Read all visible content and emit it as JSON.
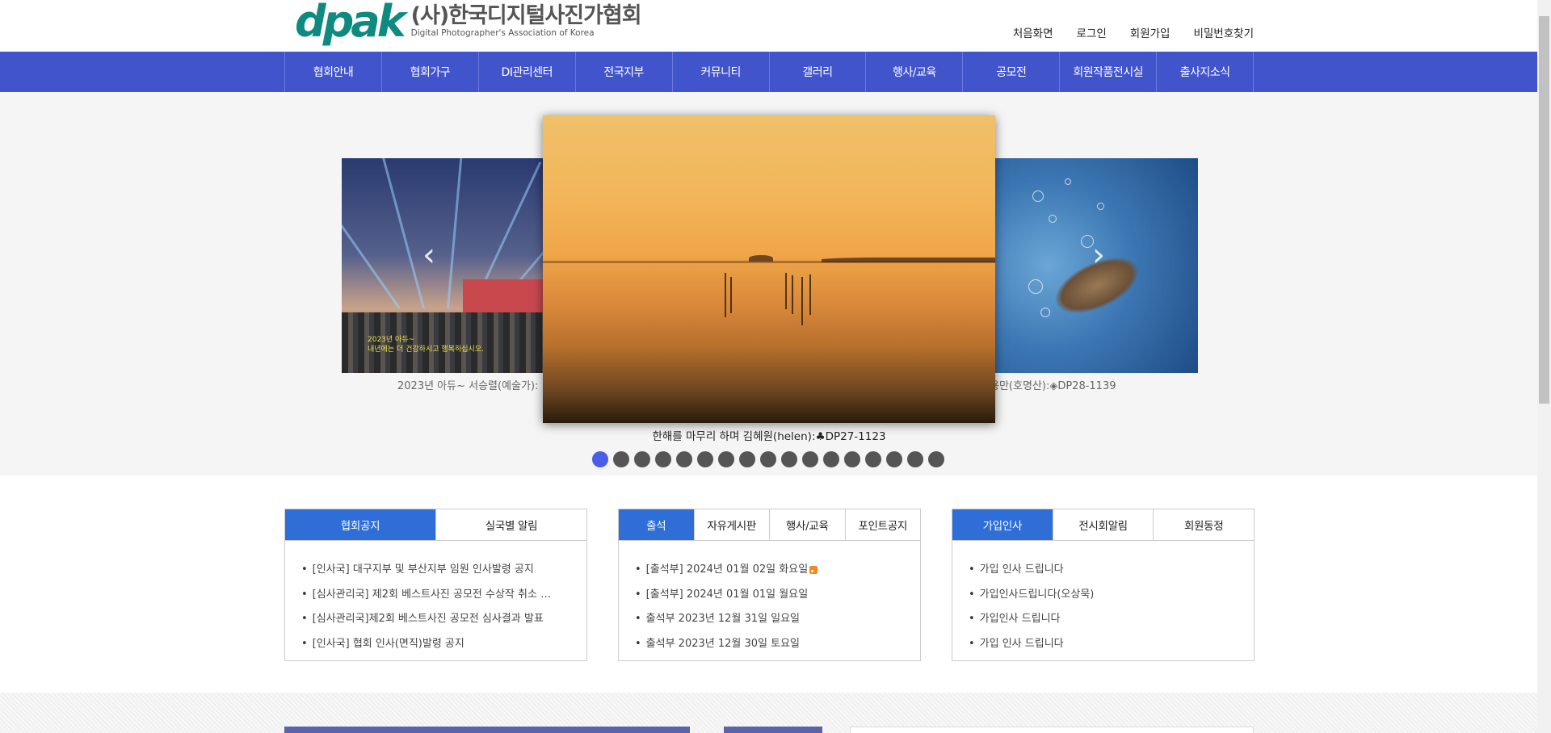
{
  "header": {
    "logo_mark": "dpak",
    "logo_title": "(사)한국디지털사진가협회",
    "logo_subtitle": "Digital Photographer's Association of Korea",
    "links": [
      "처음화면",
      "로그인",
      "회원가입",
      "비밀번호찾기"
    ]
  },
  "nav": {
    "items": [
      "협회안내",
      "협회가구",
      "DI관리센터",
      "전국지부",
      "커뮤니티",
      "갤러리",
      "행사/교육",
      "공모전",
      "회원작품전시실",
      "출사지소식"
    ]
  },
  "slider": {
    "left_overlay": "2023년 아듀~\n내년에는 더 건강하시고 행복하십시오.",
    "left_caption": "2023년 아듀~ 서승렬(예술가):",
    "right_caption": "용만(호명산):◈DP28-1139",
    "main_caption": "한해를 마무리 하며 김혜원(helen):♣DP27-1123",
    "dot_count": 17,
    "active_dot": 0,
    "prev_icon": "chevron-left-icon",
    "next_icon": "chevron-right-icon"
  },
  "boards": [
    {
      "tabs": [
        "협회공지",
        "실국별 알림"
      ],
      "active": 0,
      "items": [
        "[인사국] 대구지부 및 부산지부 임원 인사발령 공지",
        "[심사관리국] 제2회 베스트사진 공모전 수상작 취소 …",
        "[심사관리국]제2회 베스트사진 공모전 심사결과 발표",
        "[인사국] 협회 인사(면직)발령 공지"
      ]
    },
    {
      "tabs": [
        "출석",
        "자유게시판",
        "행사/교육",
        "포인트공지"
      ],
      "active": 0,
      "items": [
        "[출석부] 2024년 01월 02일 화요일",
        "[출석부] 2024년 01월 01일 월요일",
        "출석부 2023년 12월 31일 일요일",
        "출석부 2023년 12월 30일 토요일"
      ],
      "new_icon_on_first": true
    },
    {
      "tabs": [
        "가입인사",
        "전시회알림",
        "회원동정"
      ],
      "active": 0,
      "items": [
        "가입 인사 드립니다",
        "가입인사드립니다(오상묵)",
        "가입인사 드립니다",
        "가입 인사 드립니다"
      ]
    }
  ],
  "colors": {
    "nav_bg": "#4254cc",
    "tab_active": "#2e6ed6",
    "logo": "#0e8a80",
    "dot_active": "#4a5ee8"
  }
}
